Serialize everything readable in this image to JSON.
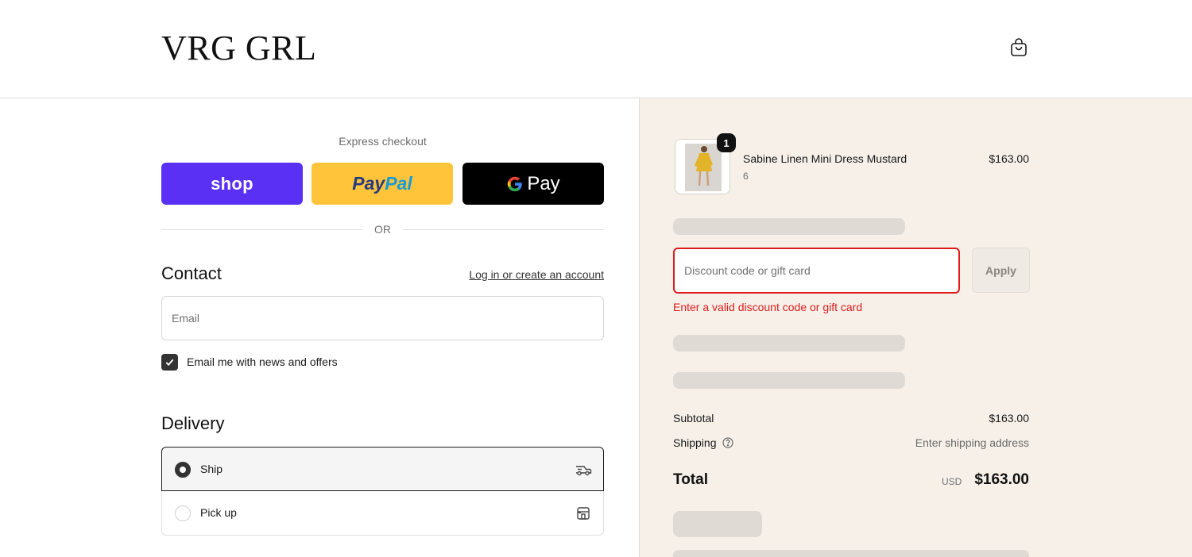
{
  "header": {
    "logo_text": "VRG GRL",
    "cart_icon": "shopping-bag-icon"
  },
  "express": {
    "title": "Express checkout",
    "shop_label": "shop",
    "paypal_label_1": "Pay",
    "paypal_label_2": "Pal",
    "gpay_label": "Pay",
    "or_text": "OR",
    "colors": {
      "shop": "#5a31f4",
      "paypal": "#ffc439",
      "gpay": "#000000"
    }
  },
  "contact": {
    "title": "Contact",
    "login_link": "Log in or create an account",
    "email_placeholder": "Email",
    "email_value": "",
    "newsletter_label": "Email me with news and offers",
    "newsletter_checked": true
  },
  "delivery": {
    "title": "Delivery",
    "options": [
      {
        "label": "Ship",
        "selected": true,
        "icon": "truck-icon"
      },
      {
        "label": "Pick up",
        "selected": false,
        "icon": "store-icon"
      }
    ]
  },
  "summary": {
    "product": {
      "name": "Sabine Linen Mini Dress Mustard",
      "variant": "6",
      "price": "$163.00",
      "quantity": "1"
    },
    "discount": {
      "placeholder": "Discount code or gift card",
      "value": "",
      "apply_label": "Apply",
      "error": "Enter a valid discount code or gift card",
      "error_color": "#dd1d1d"
    },
    "subtotal_label": "Subtotal",
    "subtotal_value": "$163.00",
    "shipping_label": "Shipping",
    "shipping_value": "Enter shipping address",
    "total_label": "Total",
    "total_currency": "USD",
    "total_value": "$163.00",
    "background_color": "#f6f0e9"
  }
}
